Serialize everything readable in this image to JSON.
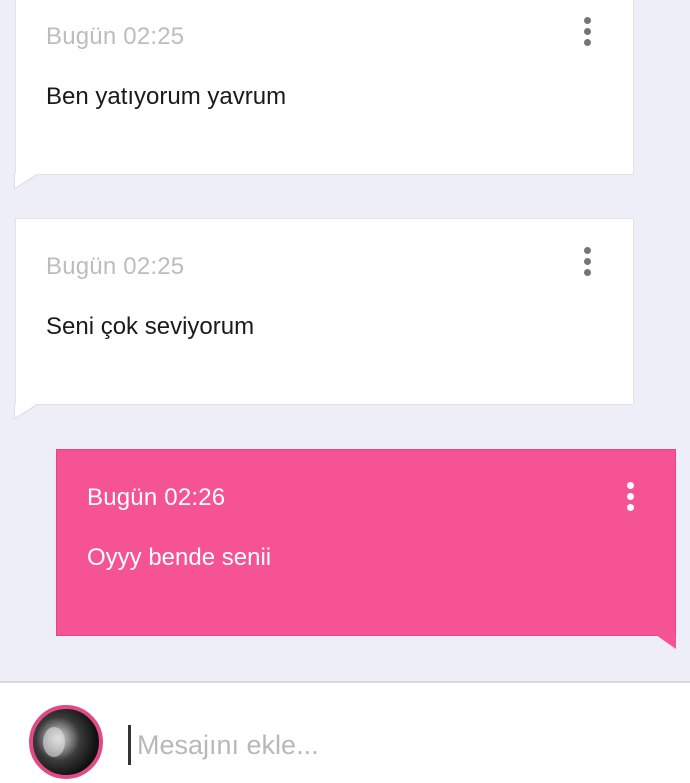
{
  "messages": [
    {
      "time": "Bugün 02:25",
      "text": "Ben yatıyorum yavrum",
      "direction": "incoming"
    },
    {
      "time": "Bugün 02:25",
      "text": "Seni çok seviyorum",
      "direction": "incoming"
    },
    {
      "time": "Bugün 02:26",
      "text": "Oyyy bende senii",
      "direction": "outgoing"
    }
  ],
  "composer": {
    "placeholder": "Mesajını ekle...",
    "value": ""
  },
  "icons": {
    "message_menu": "more-vert-icon",
    "avatar": "user-avatar"
  },
  "colors": {
    "outgoing_bubble": "#f55393",
    "incoming_bubble": "#ffffff",
    "background": "#eeeef8",
    "avatar_ring": "#e04a86"
  }
}
